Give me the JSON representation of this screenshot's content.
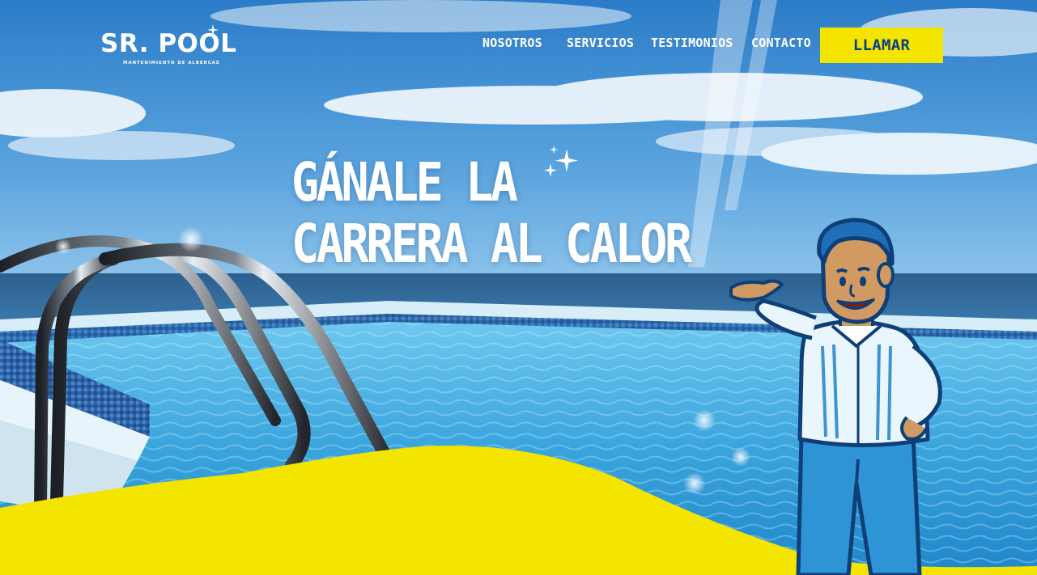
{
  "brand": {
    "name": "SR. POOL",
    "tagline": "MANTENIMIENTO DE ALBERCAS"
  },
  "nav": {
    "items": [
      {
        "label": "NOSOTROS"
      },
      {
        "label": "SERVICIOS"
      },
      {
        "label": "TESTIMONIOS"
      },
      {
        "label": "CONTACTO"
      }
    ],
    "cta_label": "LLAMAR"
  },
  "hero": {
    "headline_line1": "GÁNALE LA",
    "headline_line2": "CARRERA AL CALOR"
  },
  "colors": {
    "accent_yellow": "#f3e500",
    "cta_text": "#0d3f86",
    "sky": "#3d8fd3",
    "water": "#4fb4e4"
  },
  "icons": [
    "sparkle-icon",
    "logo-sparkle-icon"
  ]
}
